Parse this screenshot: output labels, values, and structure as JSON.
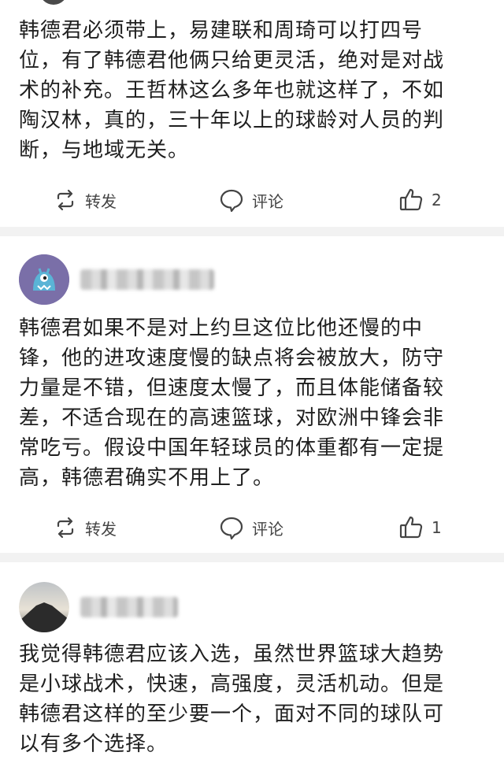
{
  "posts": [
    {
      "text": "韩德君必须带上，易建联和周琦可以打四号\n位，有了韩德君他俩只给更灵活，绝对是对战\n术的补充。王哲林这么多年也就这样了，不如\n陶汉林，真的，三十年以上的球龄对人员的判\n断，与地域无关。",
      "repost_label": "转发",
      "comment_label": "评论",
      "like_count": "2"
    },
    {
      "text": "韩德君如果不是对上约旦这位比他还慢的中\n锋，他的进攻速度慢的缺点将会被放大，防守\n力量是不错，但速度太慢了，而且体能储备较\n差，不适合现在的高速篮球，对欧洲中锋会非\n常吃亏。假设中国年轻球员的体重都有一定提\n高，韩德君确实不用上了。",
      "repost_label": "转发",
      "comment_label": "评论",
      "like_count": "1"
    },
    {
      "text": "我觉得韩德君应该入选，虽然世界篮球大趋势\n是小球战术，快速，高强度，灵活机动。但是\n韩德君这样的至少要一个，面对不同的球队可\n以有多个选择。"
    }
  ],
  "icons": {
    "repost": "repost-icon",
    "comment": "comment-icon",
    "like": "thumbs-up-icon"
  },
  "colors": {
    "text": "#1f1f1f",
    "action": "#444444",
    "separator": "#f2f2f2",
    "avatar_monster_bg": "#7a6fa8",
    "avatar_monster": "#5ab4d6"
  }
}
